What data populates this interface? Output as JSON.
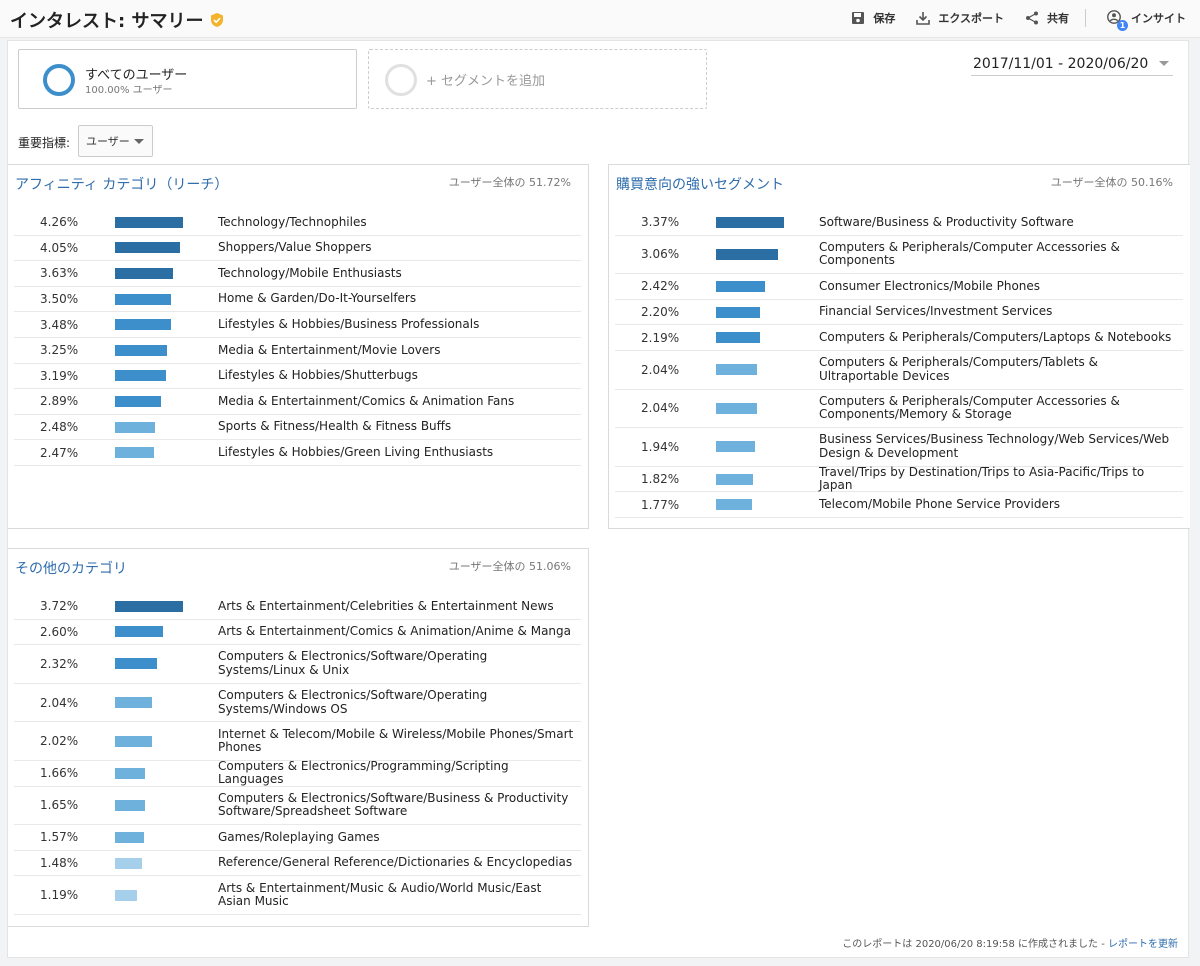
{
  "header": {
    "title": "インタレスト: サマリー",
    "actions": {
      "save": "保存",
      "export": "エクスポート",
      "share": "共有",
      "insight": "インサイト",
      "insight_count": "1"
    }
  },
  "segments": {
    "active": {
      "name": "すべてのユーザー",
      "sub": "100.00% ユーザー"
    },
    "add_label": "+ セグメントを追加"
  },
  "daterange": "2017/11/01 - 2020/06/20",
  "metric": {
    "label": "重要指標:",
    "selected": "ユーザー"
  },
  "colors": {
    "bar_dark": "#2b6ea3",
    "bar_mid": "#3d8fcb",
    "bar_light": "#6db1dc",
    "bar_pale": "#a5cfea",
    "link": "#2f6dad"
  },
  "panels": {
    "affinity": {
      "title": "アフィニティ カテゴリ（リーチ）",
      "total": "ユーザー全体の 51.72%",
      "rows": [
        {
          "pct": "4.26%",
          "value": 4.26,
          "label": "Technology/Technophiles"
        },
        {
          "pct": "4.05%",
          "value": 4.05,
          "label": "Shoppers/Value Shoppers"
        },
        {
          "pct": "3.63%",
          "value": 3.63,
          "label": "Technology/Mobile Enthusiasts"
        },
        {
          "pct": "3.50%",
          "value": 3.5,
          "label": "Home & Garden/Do-It-Yourselfers"
        },
        {
          "pct": "3.48%",
          "value": 3.48,
          "label": "Lifestyles & Hobbies/Business Professionals"
        },
        {
          "pct": "3.25%",
          "value": 3.25,
          "label": "Media & Entertainment/Movie Lovers"
        },
        {
          "pct": "3.19%",
          "value": 3.19,
          "label": "Lifestyles & Hobbies/Shutterbugs"
        },
        {
          "pct": "2.89%",
          "value": 2.89,
          "label": "Media & Entertainment/Comics & Animation Fans"
        },
        {
          "pct": "2.48%",
          "value": 2.48,
          "label": "Sports & Fitness/Health & Fitness Buffs"
        },
        {
          "pct": "2.47%",
          "value": 2.47,
          "label": "Lifestyles & Hobbies/Green Living Enthusiasts"
        }
      ]
    },
    "inmarket": {
      "title": "購買意向の強いセグメント",
      "total": "ユーザー全体の 50.16%",
      "rows": [
        {
          "pct": "3.37%",
          "value": 3.37,
          "label": "Software/Business & Productivity Software"
        },
        {
          "pct": "3.06%",
          "value": 3.06,
          "label": "Computers & Peripherals/Computer Accessories & Components"
        },
        {
          "pct": "2.42%",
          "value": 2.42,
          "label": "Consumer Electronics/Mobile Phones"
        },
        {
          "pct": "2.20%",
          "value": 2.2,
          "label": "Financial Services/Investment Services"
        },
        {
          "pct": "2.19%",
          "value": 2.19,
          "label": "Computers & Peripherals/Computers/Laptops & Notebooks"
        },
        {
          "pct": "2.04%",
          "value": 2.04,
          "label": "Computers & Peripherals/Computers/Tablets & Ultraportable Devices"
        },
        {
          "pct": "2.04%",
          "value": 2.04,
          "label": "Computers & Peripherals/Computer Accessories & Components/Memory & Storage"
        },
        {
          "pct": "1.94%",
          "value": 1.94,
          "label": "Business Services/Business Technology/Web Services/Web Design & Development"
        },
        {
          "pct": "1.82%",
          "value": 1.82,
          "label": "Travel/Trips by Destination/Trips to Asia-Pacific/Trips to Japan"
        },
        {
          "pct": "1.77%",
          "value": 1.77,
          "label": "Telecom/Mobile Phone Service Providers"
        }
      ]
    },
    "other": {
      "title": "その他のカテゴリ",
      "total": "ユーザー全体の 51.06%",
      "rows": [
        {
          "pct": "3.72%",
          "value": 3.72,
          "label": "Arts & Entertainment/Celebrities & Entertainment News"
        },
        {
          "pct": "2.60%",
          "value": 2.6,
          "label": "Arts & Entertainment/Comics & Animation/Anime & Manga"
        },
        {
          "pct": "2.32%",
          "value": 2.32,
          "label": "Computers & Electronics/Software/Operating Systems/Linux & Unix"
        },
        {
          "pct": "2.04%",
          "value": 2.04,
          "label": "Computers & Electronics/Software/Operating Systems/Windows OS"
        },
        {
          "pct": "2.02%",
          "value": 2.02,
          "label": "Internet & Telecom/Mobile & Wireless/Mobile Phones/Smart Phones"
        },
        {
          "pct": "1.66%",
          "value": 1.66,
          "label": "Computers & Electronics/Programming/Scripting Languages"
        },
        {
          "pct": "1.65%",
          "value": 1.65,
          "label": "Computers & Electronics/Software/Business & Productivity Software/Spreadsheet Software"
        },
        {
          "pct": "1.57%",
          "value": 1.57,
          "label": "Games/Roleplaying Games"
        },
        {
          "pct": "1.48%",
          "value": 1.48,
          "label": "Reference/General Reference/Dictionaries & Encyclopedias"
        },
        {
          "pct": "1.19%",
          "value": 1.19,
          "label": "Arts & Entertainment/Music & Audio/World Music/East Asian Music"
        }
      ]
    }
  },
  "footer": {
    "text": "このレポートは 2020/06/20 8:19:58 に作成されました - ",
    "link": "レポートを更新"
  }
}
